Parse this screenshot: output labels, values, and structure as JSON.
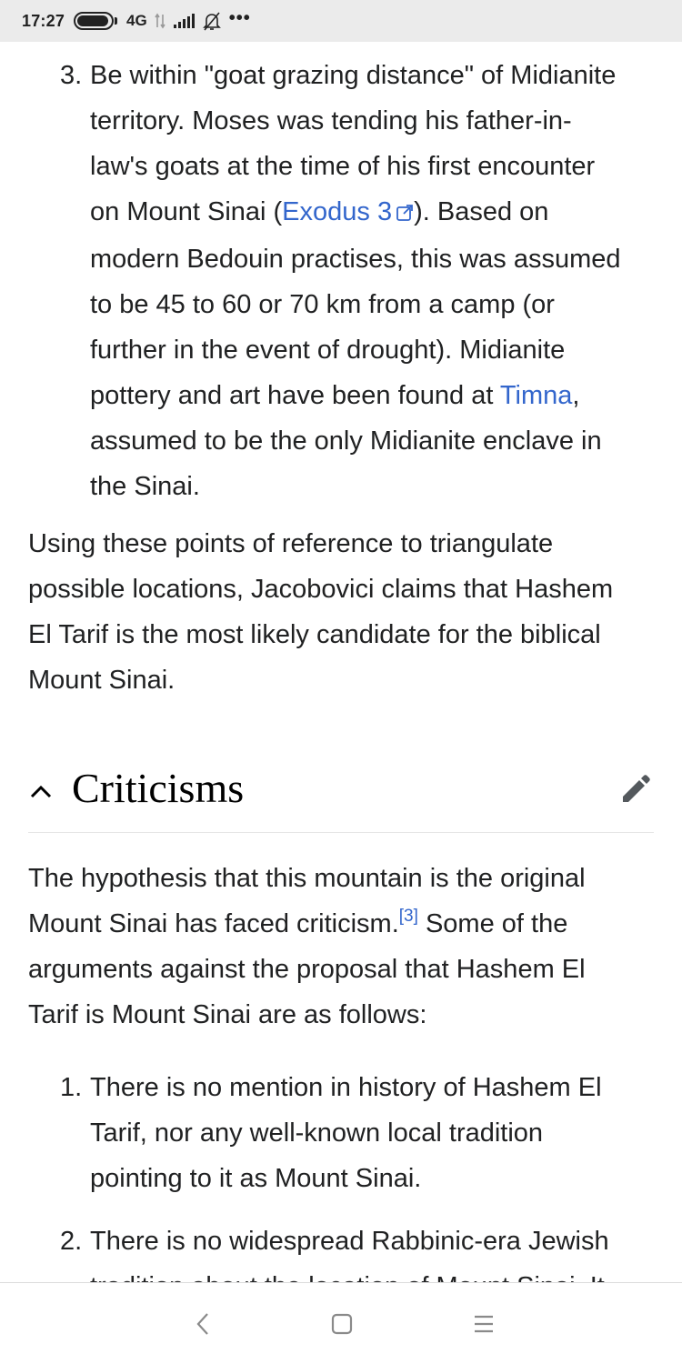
{
  "status_bar": {
    "time": "17:27",
    "network": "4G",
    "more": "•••",
    "icons": [
      "battery-icon",
      "data-arrows-icon",
      "signal-icon",
      "bell-off-icon"
    ]
  },
  "list_top": {
    "number": "3.",
    "line1": "Be within \"goat grazing distance\" of Midianite",
    "line2": "territory. Moses was tending his father-in-",
    "line3": "law's goats at the time of his first encounter",
    "line4_pre": "on Mount Sinai (",
    "line4_link": "Exodus 3",
    "line4_post": "). Based on",
    "line5": "modern Bedouin practises, this was assumed",
    "line6": "to be 45 to 60 or 70 km from a camp (or",
    "line7": "further in the event of drought). Midianite",
    "line8_pre": "pottery and art have been found at ",
    "line8_link": "Timna",
    "line8_post": ",",
    "line9": "assumed to be the only Midianite enclave in",
    "line10": "the Sinai."
  },
  "conclusion": {
    "line1": "Using these points of reference to triangulate",
    "line2": "possible locations, Jacobovici claims that Hashem",
    "line3": "El Tarif is the most likely candidate for the biblical",
    "line4": "Mount Sinai."
  },
  "section": {
    "title": "Criticisms",
    "icons": [
      "chevron-up-icon",
      "pencil-icon"
    ]
  },
  "criticism_intro": {
    "line1": "The hypothesis that this mountain is the original",
    "line2_pre": "Mount Sinai has faced criticism.",
    "line2_ref": "[3]",
    "line2_post": " Some of the",
    "line3": "arguments against the proposal that Hashem El",
    "line4": "Tarif is Mount Sinai are as follows:"
  },
  "criticism_list": [
    {
      "number": "1.",
      "lines": [
        "There is no mention in history of Hashem El",
        "Tarif, nor any well-known local tradition",
        "pointing to it as Mount Sinai."
      ]
    },
    {
      "number": "2.",
      "lines": [
        "There is no widespread Rabbinic-era Jewish",
        "tradition about the location of Mount Sinai. It"
      ]
    }
  ],
  "nav_bar": {
    "icons": [
      "back-icon",
      "home-icon",
      "menu-icon"
    ]
  }
}
